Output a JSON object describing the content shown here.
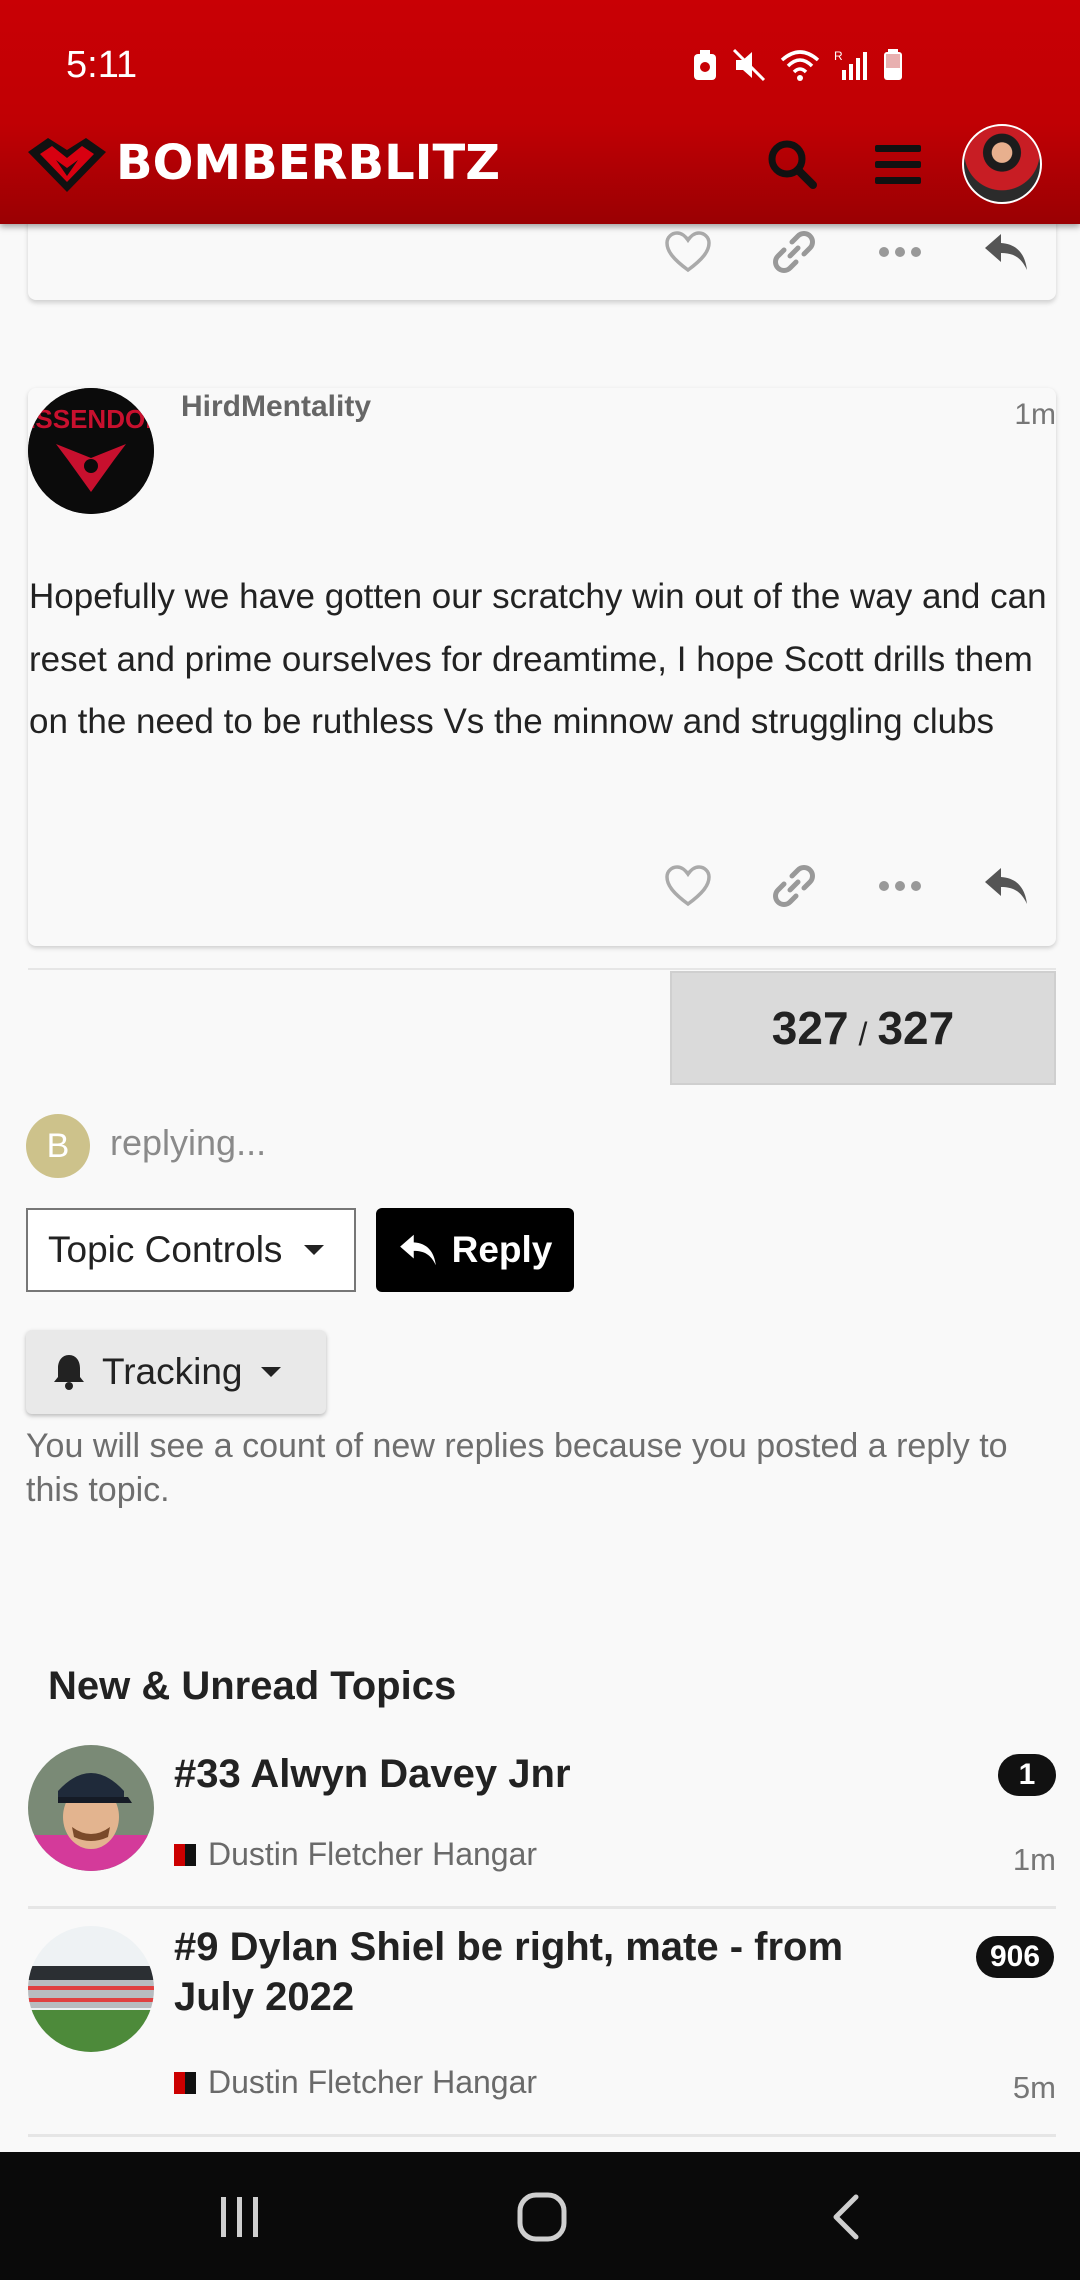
{
  "status_bar": {
    "time": "5:11"
  },
  "header": {
    "site_name": "BOMBERBLITZ",
    "accent": "#c90005"
  },
  "post": {
    "username": "HirdMentality",
    "age": "1m",
    "avatar_text": "ESSENDON",
    "body": "Hopefully we have gotten our scratchy win out of the way and can reset and prime ourselves for dreamtime, I hope Scott drills them on the need to be ruthless Vs the minnow and struggling clubs"
  },
  "progress": {
    "current": "327",
    "separator": "/",
    "total": "327"
  },
  "composer": {
    "avatar_letter": "B",
    "status": "replying..."
  },
  "controls": {
    "topic_controls_label": "Topic Controls",
    "reply_label": "Reply",
    "tracking_label": "Tracking",
    "tracking_description": "You will see a count of new replies because you posted a reply to this topic."
  },
  "suggested": {
    "title": "New & Unread Topics",
    "topics": [
      {
        "title": "#33 Alwyn Davey Jnr",
        "category": "Dustin Fletcher Hangar",
        "count": "1",
        "age": "1m"
      },
      {
        "title": "#9 Dylan Shiel be right, mate - from July 2022",
        "category": "Dustin Fletcher Hangar",
        "count": "906",
        "age": "5m"
      }
    ]
  }
}
